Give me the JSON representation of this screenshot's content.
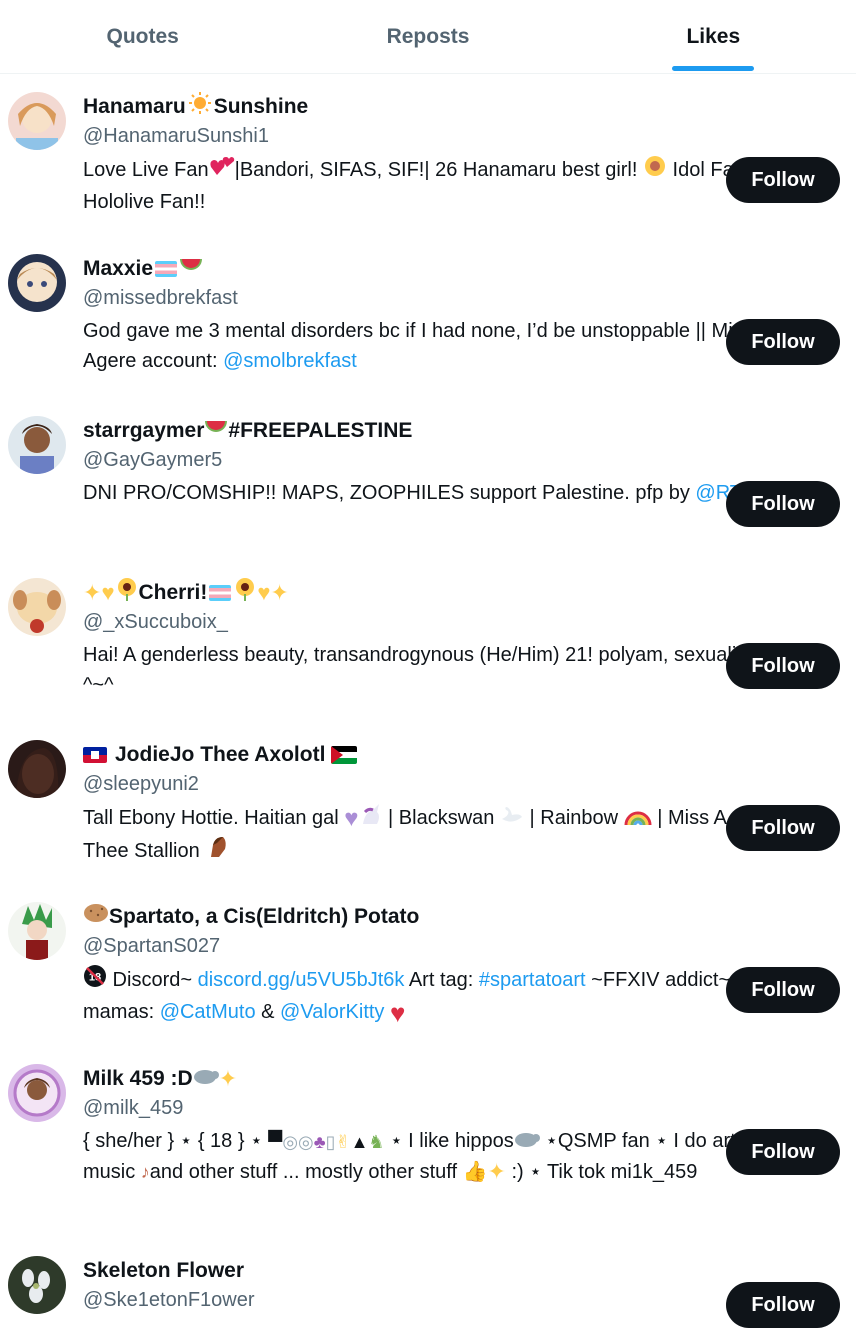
{
  "tabs": [
    {
      "label": "Quotes",
      "active": false
    },
    {
      "label": "Reposts",
      "active": false
    },
    {
      "label": "Likes",
      "active": true
    }
  ],
  "colors": {
    "accent": "#1d9bf0",
    "follow_bg": "#0f1419",
    "muted": "#536471"
  },
  "users": [
    {
      "name": "Hanamaru",
      "name_suffix": "Sunshine",
      "handle": "@HanamaruSunshi1",
      "follow_label": "Follow",
      "bio_1": "Love Live Fan",
      "bio_2": "|Bandori, SIFAS, SIF!| 26 Hanamaru best girl! ",
      "bio_3": " Idol Fan!| Hololive Fan!!"
    },
    {
      "name": "Maxxie",
      "handle": "@missedbrekfast",
      "follow_label": "Follow",
      "bio_1": "God gave me 3 mental disorders bc if I had none, I’d be unstoppable || Minor(17) || Agere account: ",
      "bio_link": "@smolbrekfast"
    },
    {
      "name": "starrgaymer",
      "name_suffix": " #FREEPALESTINE",
      "handle": "@GayGaymer5",
      "follow_label": "Follow",
      "bio_1": "DNI PRO/COMSHIP!! MAPS, ZOOPHILES support Palestine. pfp by ",
      "bio_link": "@RT_2756"
    },
    {
      "name": "Cherri!",
      "handle": "@_xSuccuboix_",
      "follow_label": "Follow",
      "bio_1": "Hai! A genderless beauty, transandrogynous (He/Him) 21! polyam, sexuality is vibes ^~^"
    },
    {
      "name": "JodieJo Thee Axolotl",
      "handle": "@sleepyuni2",
      "follow_label": "Follow",
      "bio_1": "Tall Ebony Hottie. Haitian gal ",
      "bio_2": " | Blackswan ",
      "bio_3": " | Rainbow ",
      "bio_4": " | Miss A ",
      "bio_5": "| Megan Thee Stallion "
    },
    {
      "name": "Spartato, a Cis(Eldritch) Potato",
      "handle": "@SpartanS027",
      "follow_label": "Follow",
      "bio_1": " Discord~ ",
      "bio_link_1": "discord.gg/u5VU5bJt6k",
      "bio_2": " Art tag: ",
      "bio_link_2": "#spartatoart",
      "bio_3": " ~FFXIV addict~ Model mamas: ",
      "bio_link_3": "@CatMuto",
      "bio_4": " & ",
      "bio_link_4": "@ValorKitty"
    },
    {
      "name": "Milk 459 :D ",
      "handle": "@milk_459",
      "follow_label": "Follow",
      "bio_1": "{ she/her } ⋆ { 18 } ⋆ ",
      "bio_2": " ⋆ I like hippos",
      "bio_3": " ⋆QSMP fan ⋆ I do art and music ",
      "bio_4": "and other stuff ... mostly other stuff ",
      "bio_5": " :) ⋆ Tik tok mi1k_459"
    },
    {
      "name": "Skeleton Flower",
      "handle": "@Ske1etonF1ower",
      "follow_label": "Follow"
    }
  ]
}
